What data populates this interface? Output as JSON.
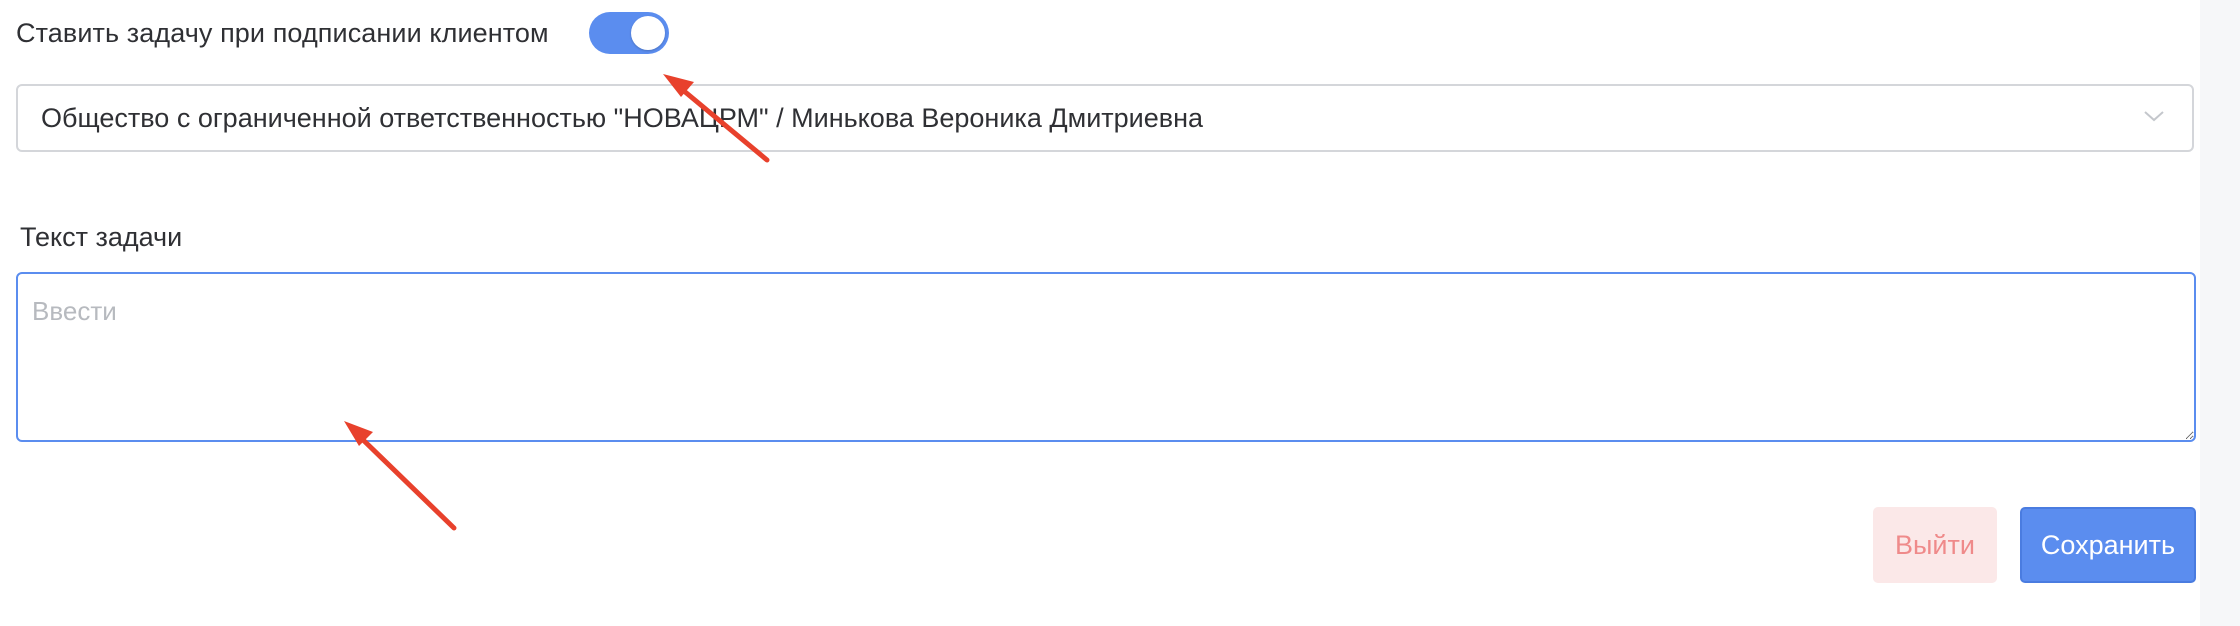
{
  "toggle": {
    "label": "Ставить задачу при подписании клиентом",
    "state": "on",
    "accent_color": "#5b8def"
  },
  "select": {
    "value": "Общество с ограниченной ответственностью \"НОВАЦРМ\" / Минькова Вероника Дмитриевна",
    "icon": "chevron-down-icon"
  },
  "task": {
    "label": "Текст задачи",
    "value": "",
    "placeholder": "Ввести"
  },
  "actions": {
    "exit_label": "Выйти",
    "save_label": "Сохранить"
  },
  "annotations": {
    "arrow_color": "#e8412c"
  }
}
